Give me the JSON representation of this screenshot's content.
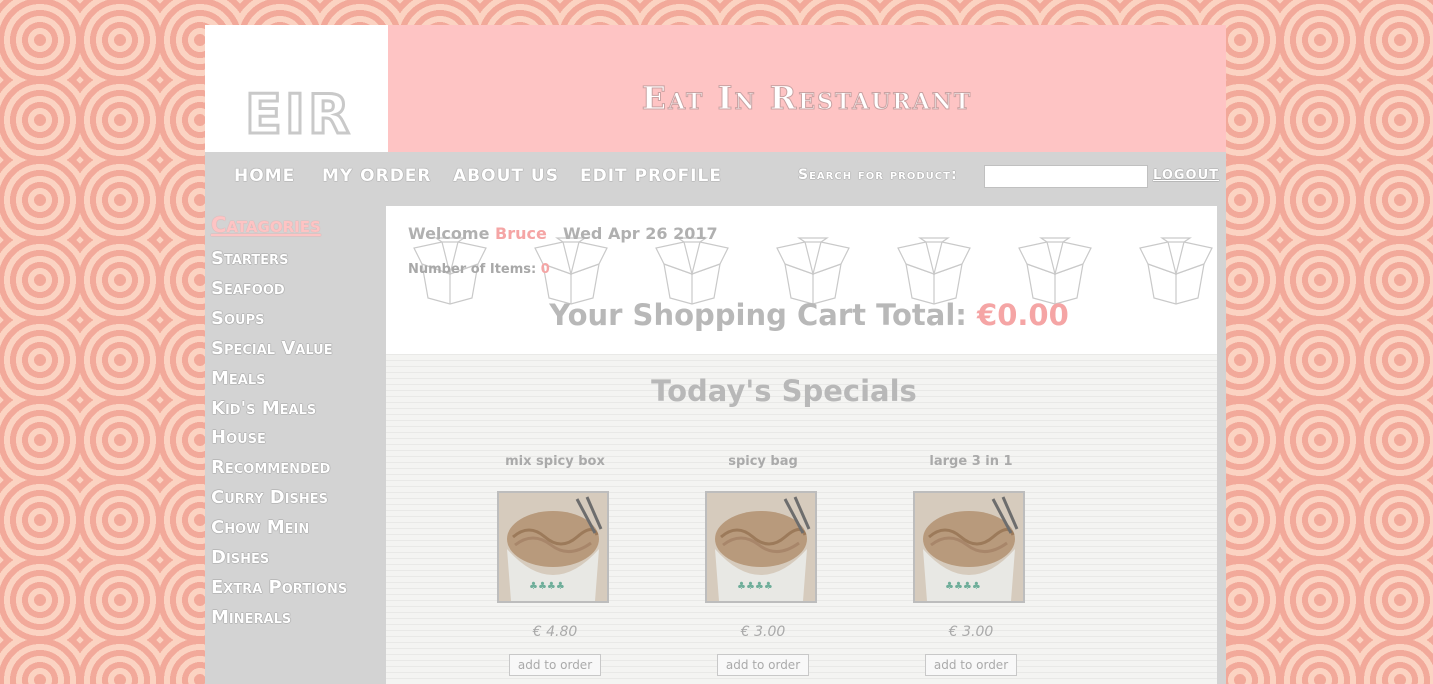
{
  "header": {
    "logo": "EIR",
    "title": "Eat In Restaurant"
  },
  "nav": {
    "items": [
      {
        "label": "Home"
      },
      {
        "label": "My Order"
      },
      {
        "label": "About Us"
      },
      {
        "label": "Edit Profile"
      }
    ],
    "search_label": "Search for product:",
    "search_value": "",
    "logout_label": "Logout"
  },
  "sidebar": {
    "heading": "Catagories",
    "items": [
      "Starters",
      "Seafood",
      "Soups",
      "Special Value",
      "Meals",
      "Kid's Meals",
      "House",
      "Recommended",
      "Curry Dishes",
      "Chow Mein",
      "Dishes",
      "Extra Portions",
      "Minerals"
    ]
  },
  "cart": {
    "welcome_label": "Welcome",
    "user_name": "Bruce",
    "date": "Wed Apr 26 2017",
    "items_label": "Number of Items:",
    "items_count": "0",
    "total_label": "Your Shopping Cart Total:",
    "total_amount": "€0.00"
  },
  "specials": {
    "title": "Today's Specials",
    "products": [
      {
        "name": "mix spicy box",
        "price": "€ 4.80",
        "button": "add to order"
      },
      {
        "name": "spicy bag",
        "price": "€ 3.00",
        "button": "add to order"
      },
      {
        "name": "large 3 in 1",
        "price": "€ 3.00",
        "button": "add to order"
      }
    ]
  },
  "colors": {
    "accent_pink": "#fec4c4",
    "highlight_pink": "#f5a5a5",
    "nav_gray": "#d3d3d3"
  }
}
